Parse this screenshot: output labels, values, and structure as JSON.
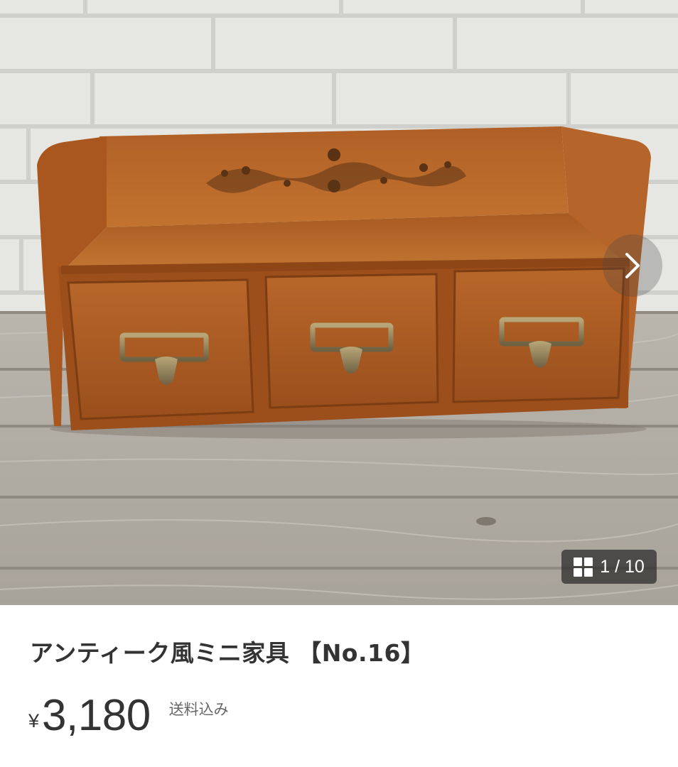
{
  "gallery": {
    "image_alt": "",
    "counter_current": "1",
    "counter_total": "10",
    "counter_text": "1 / 10",
    "grid_icon": "grid-icon",
    "next_icon": "chevron-right-icon"
  },
  "product": {
    "title": "アンティーク風ミニ家具 【No.16】",
    "currency_symbol": "¥",
    "price": "3,180",
    "shipping_note": "送料込み"
  },
  "colors": {
    "text_primary": "#333333",
    "text_secondary": "#666666",
    "badge_bg": "#2f2f2f"
  }
}
